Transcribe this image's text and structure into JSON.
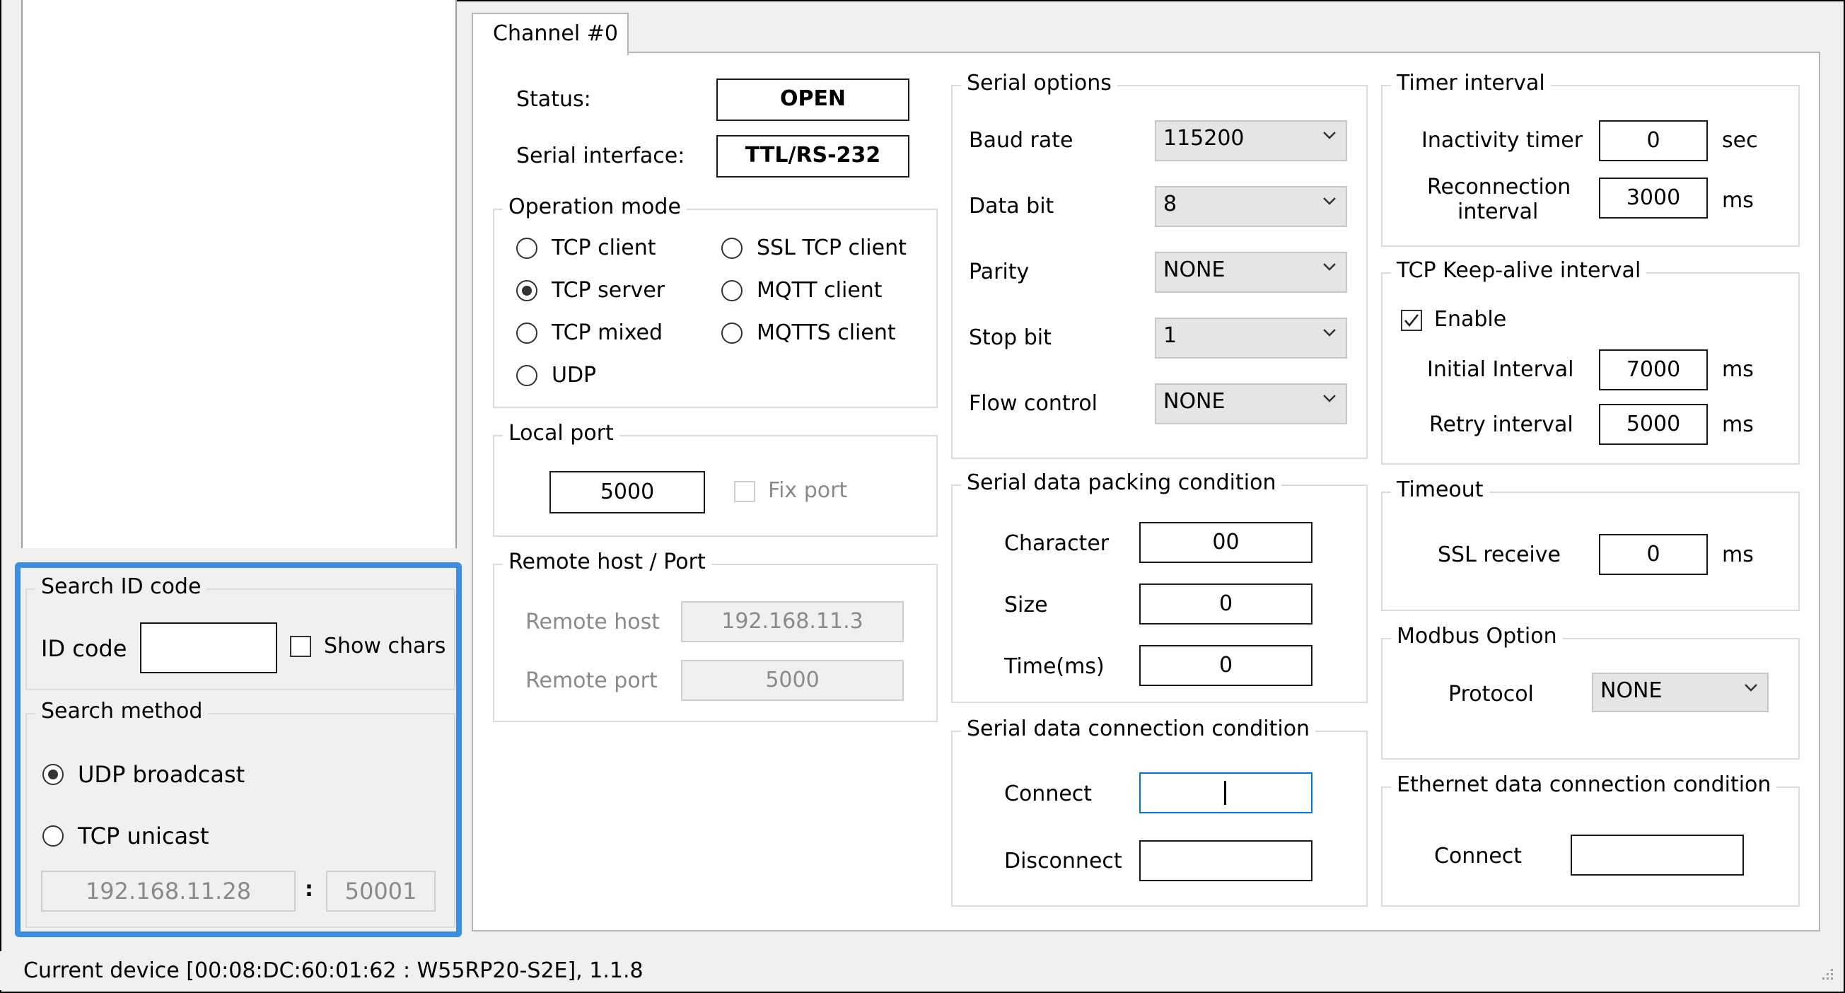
{
  "tab": {
    "label": "Channel #0"
  },
  "status_section": {
    "status_label": "Status:",
    "status_value": "OPEN",
    "serial_interface_label": "Serial interface:",
    "serial_interface_value": "TTL/RS-232"
  },
  "operation_mode": {
    "title": "Operation mode",
    "options": [
      {
        "label": "TCP client",
        "selected": false
      },
      {
        "label": "TCP server",
        "selected": true
      },
      {
        "label": "TCP mixed",
        "selected": false
      },
      {
        "label": "UDP",
        "selected": false
      },
      {
        "label": "SSL TCP client",
        "selected": false
      },
      {
        "label": "MQTT client",
        "selected": false
      },
      {
        "label": "MQTTS client",
        "selected": false
      }
    ]
  },
  "local_port": {
    "title": "Local port",
    "value": "5000",
    "fix_port_label": "Fix port"
  },
  "remote": {
    "title": "Remote host / Port",
    "host_label": "Remote host",
    "host_value": "192.168.11.3",
    "port_label": "Remote port",
    "port_value": "5000"
  },
  "serial_options": {
    "title": "Serial options",
    "baud_label": "Baud rate",
    "baud_value": "115200",
    "databit_label": "Data bit",
    "databit_value": "8",
    "parity_label": "Parity",
    "parity_value": "NONE",
    "stopbit_label": "Stop bit",
    "stopbit_value": "1",
    "flow_label": "Flow control",
    "flow_value": "NONE"
  },
  "packing": {
    "title": "Serial data packing condition",
    "char_label": "Character",
    "char_value": "00",
    "size_label": "Size",
    "size_value": "0",
    "time_label": "Time(ms)",
    "time_value": "0"
  },
  "serial_conn": {
    "title": "Serial data connection condition",
    "connect_label": "Connect",
    "connect_value": "",
    "disconnect_label": "Disconnect",
    "disconnect_value": ""
  },
  "timer": {
    "title": "Timer interval",
    "inactivity_label": "Inactivity timer",
    "inactivity_value": "0",
    "inactivity_unit": "sec",
    "reconnect_label_1": "Reconnection",
    "reconnect_label_2": "interval",
    "reconnect_value": "3000",
    "reconnect_unit": "ms"
  },
  "keepalive": {
    "title": "TCP Keep-alive interval",
    "enable_label": "Enable",
    "initial_label": "Initial Interval",
    "initial_value": "7000",
    "initial_unit": "ms",
    "retry_label": "Retry interval",
    "retry_value": "5000",
    "retry_unit": "ms"
  },
  "timeout": {
    "title": "Timeout",
    "ssl_label": "SSL receive",
    "ssl_value": "0",
    "ssl_unit": "ms"
  },
  "modbus": {
    "title": "Modbus Option",
    "protocol_label": "Protocol",
    "protocol_value": "NONE"
  },
  "eth_conn": {
    "title": "Ethernet data connection condition",
    "connect_label": "Connect",
    "connect_value": ""
  },
  "search_id": {
    "title": "Search ID code",
    "id_label": "ID code",
    "id_value": "",
    "show_chars_label": "Show chars"
  },
  "search_method": {
    "title": "Search method",
    "udp_label": "UDP broadcast",
    "tcp_label": "TCP unicast",
    "ip_value": "192.168.11.28",
    "separator": ":",
    "port_value": "50001"
  },
  "statusbar": {
    "text": "Current device [00:08:DC:60:01:62 : W55RP20-S2E], 1.1.8"
  },
  "colors": {
    "highlight": "#3d8ee0",
    "focus_border": "#0078d7"
  }
}
